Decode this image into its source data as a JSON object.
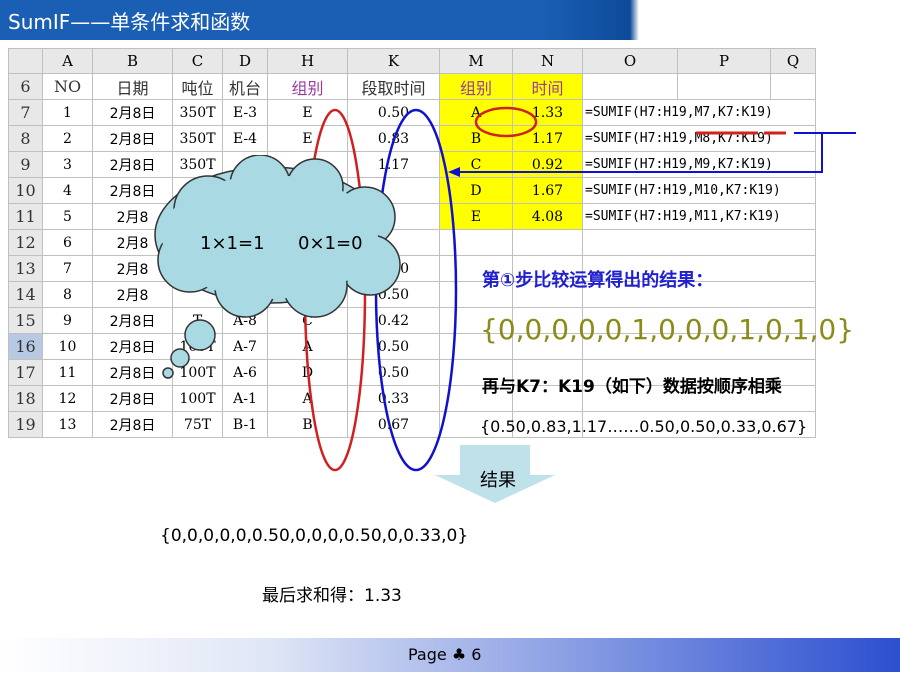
{
  "title": "SumIF——单条件求和函数",
  "columns": [
    "A",
    "B",
    "C",
    "D",
    "H",
    "K",
    "M",
    "N",
    "O",
    "P",
    "Q"
  ],
  "header_row": {
    "num": "6",
    "cells": [
      "NO",
      "日期",
      "吨位",
      "机台",
      "组别",
      "段取时间",
      "组别",
      "时间",
      "",
      "",
      ""
    ]
  },
  "rows": [
    {
      "num": "7",
      "a": "1",
      "b": "2月8日",
      "c": "350T",
      "d": "E-3",
      "h": "E",
      "k": "0.50",
      "m": "A",
      "n": "1.33",
      "f": "=SUMIF(H7:H19,M7,K7:K19)"
    },
    {
      "num": "8",
      "a": "2",
      "b": "2月8日",
      "c": "350T",
      "d": "E-4",
      "h": "E",
      "k": "0.83",
      "m": "B",
      "n": "1.17",
      "f": "=SUMIF(H7:H19,M8,K7:K19)"
    },
    {
      "num": "9",
      "a": "3",
      "b": "2月8日",
      "c": "350T",
      "d": "",
      "h": "",
      "k": "1.17",
      "m": "C",
      "n": "0.92",
      "f": "=SUMIF(H7:H19,M9,K7:K19)"
    },
    {
      "num": "10",
      "a": "4",
      "b": "2月8日",
      "c": "",
      "d": "",
      "h": "",
      "k": "",
      "m": "D",
      "n": "1.67",
      "f": "=SUMIF(H7:H19,M10,K7:K19)"
    },
    {
      "num": "11",
      "a": "5",
      "b": "2月8",
      "c": "",
      "d": "",
      "h": "",
      "k": "",
      "m": "E",
      "n": "4.08",
      "f": "=SUMIF(H7:H19,M11,K7:K19)"
    },
    {
      "num": "12",
      "a": "6",
      "b": "2月8",
      "c": "",
      "d": "",
      "h": "",
      "k": "",
      "m": "",
      "n": "",
      "f": ""
    },
    {
      "num": "13",
      "a": "7",
      "b": "2月8",
      "c": "",
      "d": "",
      "h": "",
      "k": "0.50",
      "m": "",
      "n": "",
      "f": ""
    },
    {
      "num": "14",
      "a": "8",
      "b": "2月8",
      "c": "",
      "d": "",
      "h": "",
      "k": "0.50",
      "m": "",
      "n": "",
      "f": ""
    },
    {
      "num": "15",
      "a": "9",
      "b": "2月8日",
      "c": "T",
      "d": "A-8",
      "h": "C",
      "k": "0.42",
      "m": "",
      "n": "",
      "f": ""
    },
    {
      "num": "16",
      "a": "10",
      "b": "2月8日",
      "c": "100T",
      "d": "A-7",
      "h": "A",
      "k": "0.50",
      "m": "",
      "n": "",
      "f": ""
    },
    {
      "num": "17",
      "a": "11",
      "b": "2月8日",
      "c": "100T",
      "d": "A-6",
      "h": "D",
      "k": "0.50",
      "m": "",
      "n": "",
      "f": ""
    },
    {
      "num": "18",
      "a": "12",
      "b": "2月8日",
      "c": "100T",
      "d": "A-1",
      "h": "A",
      "k": "0.33",
      "m": "",
      "n": "",
      "f": ""
    },
    {
      "num": "19",
      "a": "13",
      "b": "2月8日",
      "c": "75T",
      "d": "B-1",
      "h": "B",
      "k": "0.67",
      "m": "",
      "n": "",
      "f": ""
    }
  ],
  "cloud": {
    "text1": "1×1=1",
    "text2": "0×1=0"
  },
  "notes": {
    "step1": "第①步比较运算得出的结果：",
    "array1": "{0,0,0,0,0,1,0,0,0,1,0,1,0}",
    "multiply": "再与K7：K19（如下）数据按顺序相乘",
    "array2": "{0.50,0.83,1.17……0.50,0.50,0.33,0.67}"
  },
  "result_label": "结果",
  "result": "{0,0,0,0,0,0.50,0,0,0,0.50,0,0.33,0}",
  "final": "最后求和得：1.33",
  "footer": {
    "page": "Page ♣ 6"
  },
  "colors": {
    "title_bar": "#1a5fb4",
    "highlight": "#ffff00",
    "red_ellipse": "#d02020",
    "blue_ellipse": "#1010d0"
  }
}
